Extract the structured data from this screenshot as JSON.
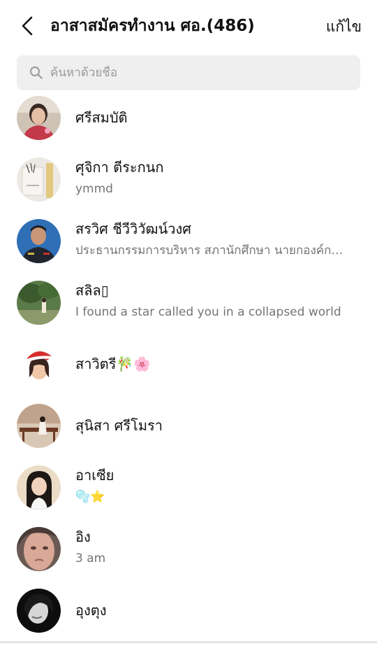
{
  "header": {
    "back_icon": "chevron-left-icon",
    "title": "อาสาสมัครทำงาน ศอ.(486)",
    "edit_label": "แก้ไข"
  },
  "search": {
    "icon": "search-icon",
    "placeholder": "ค้นหาด้วยชื่อ"
  },
  "members": [
    {
      "name": "ศรีสมบัติ",
      "subtitle": ""
    },
    {
      "name": "ศุจิกา ตีระกนก",
      "subtitle": "ymmd"
    },
    {
      "name": "สรวิศ ชีวีวิวัฒน์วงศ",
      "subtitle": "ประธานกรรมการบริหาร สภานักศึกษา นายกองค์การนักศึกษา"
    },
    {
      "name": "สลิล▯",
      "subtitle": "I found a star called you in a collapsed world"
    },
    {
      "name": "สาวิตรี🎋🌸",
      "subtitle": ""
    },
    {
      "name": "สุนิสา ศรีโมรา",
      "subtitle": ""
    },
    {
      "name": "อาเซีย",
      "subtitle": "🫧⭐"
    },
    {
      "name": "อิง",
      "subtitle": "3 am"
    },
    {
      "name": "อุงตุง",
      "subtitle": ""
    }
  ],
  "colors": {
    "search_bg": "#efefef",
    "subtitle": "#757575"
  }
}
